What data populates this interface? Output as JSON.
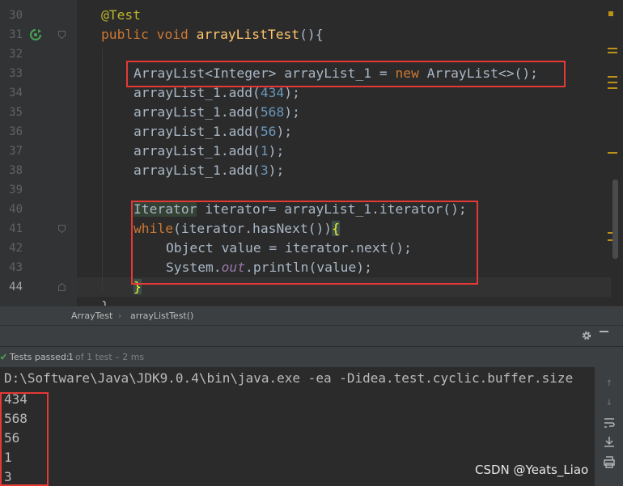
{
  "editor": {
    "line_numbers": [
      "30",
      "31",
      "32",
      "33",
      "34",
      "35",
      "36",
      "37",
      "38",
      "39",
      "40",
      "41",
      "42",
      "43",
      "44"
    ],
    "line30": {
      "annotation": "@Test"
    },
    "line31": {
      "kw1": "public",
      "kw2": "void",
      "method": "arrayListTest",
      "rest": "(){"
    },
    "line33": {
      "t1": "ArrayList<Integer> arrayList_1 = ",
      "kw": "new",
      "t2": " ArrayList<>();"
    },
    "adds": [
      {
        "pre": "arrayList_1.add(",
        "num": "434",
        "post": ");"
      },
      {
        "pre": "arrayList_1.add(",
        "num": "568",
        "post": ");"
      },
      {
        "pre": "arrayList_1.add(",
        "num": "56",
        "post": ");"
      },
      {
        "pre": "arrayList_1.add(",
        "num": "1",
        "post": ");"
      },
      {
        "pre": "arrayList_1.add(",
        "num": "3",
        "post": ");"
      }
    ],
    "line40": {
      "type": "Iterator",
      "rest": " iterator= arrayList_1.iterator();"
    },
    "line41": {
      "kw": "while",
      "mid": "(iterator.hasNext())",
      "brace": "{"
    },
    "line42": {
      "text": "Object value = iterator.next();"
    },
    "line43": {
      "pre": "System.",
      "field": "out",
      "post": ".println(value);"
    },
    "line44": {
      "brace": "}"
    },
    "line45": {
      "text": "}"
    }
  },
  "breadcrumb": {
    "class_name": "ArrayTest",
    "separator": "›",
    "method_name": "arrayListTest()"
  },
  "toolwindow": {
    "settings_icon": "gear-icon"
  },
  "status": {
    "passed_label": "Tests passed:",
    "count": "1",
    "rest": "of 1 test – 2 ms"
  },
  "console": {
    "command": "D:\\Software\\Java\\JDK9.0.4\\bin\\java.exe -ea -Didea.test.cyclic.buffer.size",
    "output": [
      "434",
      "568",
      "56",
      "1",
      "3"
    ]
  },
  "right_toolbar": {
    "icons": [
      "arrow-up-icon",
      "arrow-down-icon",
      "soft-wrap-icon",
      "scroll-to-end-icon",
      "print-icon"
    ]
  },
  "watermark": "CSDN @Yeats_Liao",
  "colors": {
    "highlight_box": "#e53935",
    "keyword": "#cc7832",
    "number": "#6897bb",
    "method": "#ffc66d",
    "status_ok": "#499c54"
  }
}
